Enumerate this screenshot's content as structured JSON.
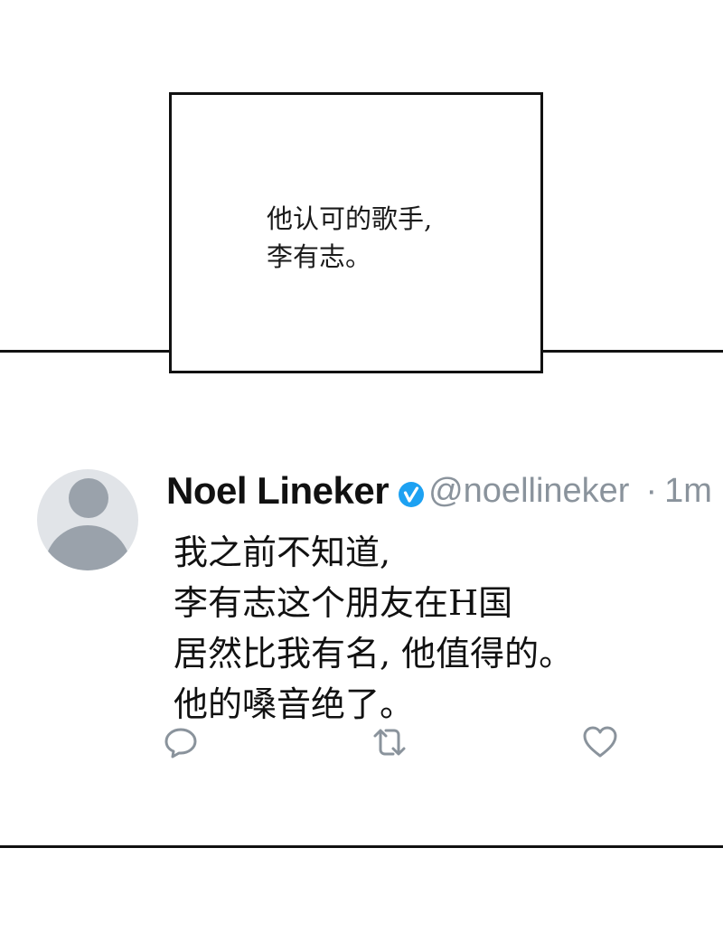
{
  "caption": {
    "lines": [
      "他认可的歌手,",
      "李有志。"
    ]
  },
  "tweet": {
    "display_name": "Noel Lineker",
    "handle": "@noellineker",
    "separator": "·",
    "timestamp": "1m",
    "verified_icon": "verified-badge-icon",
    "body_lines": [
      "我之前不知道,",
      "李有志这个朋友在H国",
      "居然比我有名, 他值得的。",
      "他的嗓音绝了。"
    ],
    "actions": {
      "reply_icon": "reply-icon",
      "retweet_icon": "retweet-icon",
      "like_icon": "heart-icon"
    }
  },
  "colors": {
    "verified": "#1da1f2",
    "muted_text": "#8a939c",
    "icon_stroke": "#8a939c",
    "avatar_bg": "#e1e4e8",
    "avatar_fg": "#9aa2ab",
    "border": "#111111"
  }
}
